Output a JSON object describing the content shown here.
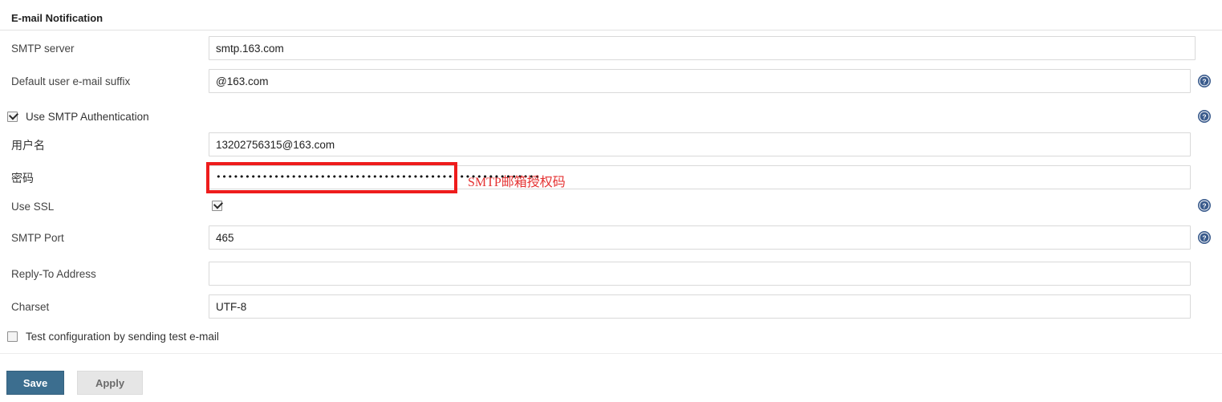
{
  "section": {
    "title": "E-mail Notification"
  },
  "rows": {
    "smtp_server": {
      "label": "SMTP server",
      "value": "smtp.163.com"
    },
    "email_suffix": {
      "label": "Default user e-mail suffix",
      "value": "@163.com"
    },
    "smtp_auth": {
      "label": "Use SMTP Authentication",
      "checked": true
    },
    "username": {
      "label": "用户名",
      "value": "13202756315@163.com"
    },
    "password": {
      "label": "密码",
      "value": "••••••••••••••••••••••••••••••••••••••••••••••••••••••••"
    },
    "use_ssl": {
      "label": "Use SSL",
      "checked": true
    },
    "smtp_port": {
      "label": "SMTP Port",
      "value": "465"
    },
    "reply_to": {
      "label": "Reply-To Address",
      "value": "",
      "placeholder": ""
    },
    "charset": {
      "label": "Charset",
      "value": "UTF-8"
    },
    "test_config": {
      "label": "Test configuration by sending test e-mail",
      "checked": false
    }
  },
  "annotation": {
    "note": "SMTP邮箱授权码",
    "box_color": "#ee1c1c",
    "text_color": "#e53232"
  },
  "icons": {
    "help": "help-circle-icon",
    "help_color": "#3a5b8c"
  },
  "footer": {
    "save_label": "Save",
    "apply_label": "Apply",
    "save_color": "#3c6e8f",
    "apply_color": "#e6e6e6"
  }
}
